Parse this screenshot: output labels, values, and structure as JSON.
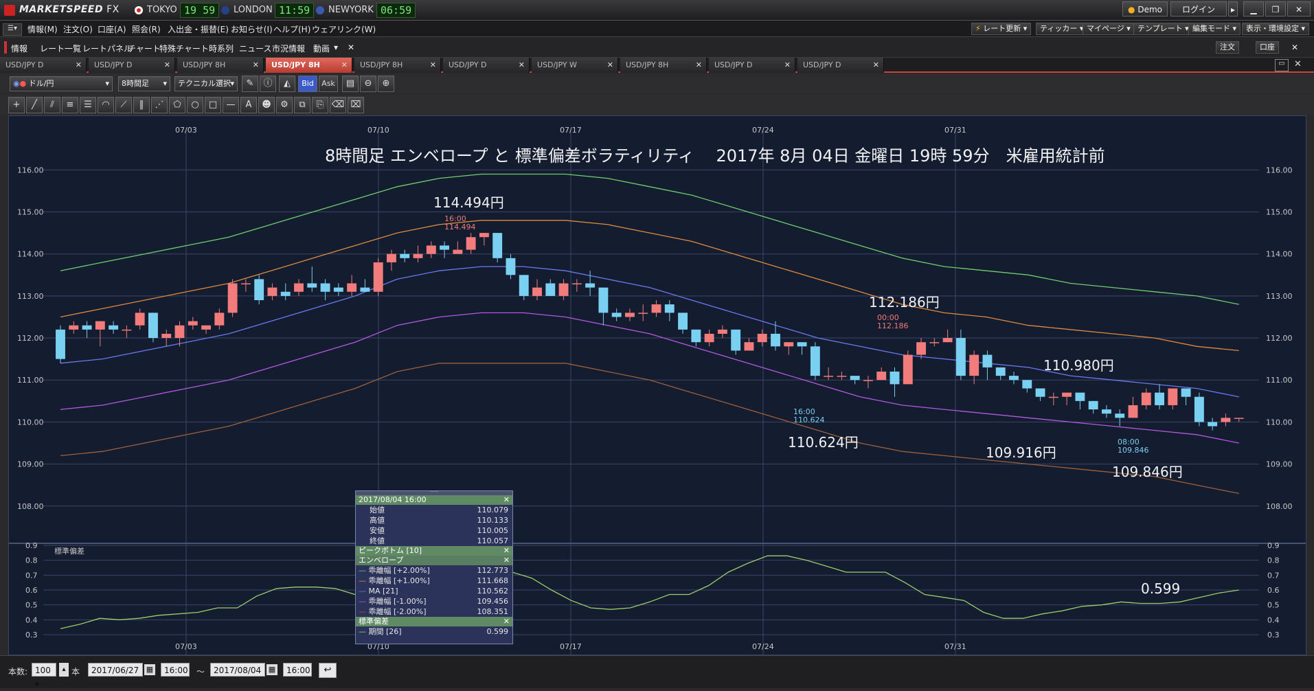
{
  "app": {
    "brand": "MARKETSPEED",
    "brand_suffix": "FX",
    "clocks": [
      {
        "city": "TOKYO",
        "time": "19 59"
      },
      {
        "city": "LONDON",
        "time": "11:59"
      },
      {
        "city": "NEWYORK",
        "time": "06:59"
      }
    ],
    "demo_label": "Demo",
    "login_label": "ログイン"
  },
  "menu": [
    "情報(M)",
    "注文(O)",
    "口座(A)",
    "照会(R)",
    "入出金・振替(E)",
    "お知らせ(I)",
    "ヘルプ(H)",
    "ウェアリンク(W)"
  ],
  "right_menu": [
    "レート更新",
    "ティッカー",
    "マイページ",
    "テンプレート",
    "編集モード",
    "表示・環境設定"
  ],
  "func_items": [
    "情報",
    "レート一覧",
    "レートパネル",
    "チャート",
    "特殊チャート",
    "時系列",
    "ニュース",
    "市況情報",
    "動画"
  ],
  "func_right": [
    "注文",
    "口座"
  ],
  "tabs": [
    "USD/JPY D",
    "USD/JPY D",
    "USD/JPY 8H",
    "USD/JPY 8H",
    "USD/JPY 8H",
    "USD/JPY D",
    "USD/JPY W",
    "USD/JPY 8H",
    "USD/JPY D",
    "USD/JPY D"
  ],
  "active_tab": 3,
  "toolbar": {
    "pair": "ドル/円",
    "interval": "8時間足",
    "technical": "テクニカル選択",
    "bid": "Bid",
    "ask": "Ask"
  },
  "chart_data": {
    "type": "candlestick",
    "title": "8時間足 エンベロープ と 標準偏差ボラティリティ　 2017年 8月 04日 金曜日 19時 59分　米雇用統計前",
    "x_dates": [
      "07/03",
      "07/10",
      "07/17",
      "07/24",
      "07/31"
    ],
    "y_ticks": [
      "116.00",
      "115.00",
      "114.00",
      "113.00",
      "112.00",
      "111.00",
      "110.00",
      "109.00",
      "108.00"
    ],
    "ylim": [
      107.8,
      116.3
    ],
    "candles": [
      [
        112.2,
        111.5,
        112.3,
        111.4
      ],
      [
        112.2,
        112.3,
        112.4,
        112.1
      ],
      [
        112.3,
        112.2,
        112.4,
        112.0
      ],
      [
        112.2,
        112.4,
        112.4,
        111.8
      ],
      [
        112.3,
        112.2,
        112.4,
        112.1
      ],
      [
        112.2,
        112.2,
        112.3,
        112.0
      ],
      [
        112.3,
        112.6,
        112.7,
        112.2
      ],
      [
        112.6,
        112.0,
        112.6,
        111.9
      ],
      [
        112.0,
        112.1,
        112.2,
        111.8
      ],
      [
        112.0,
        112.3,
        112.4,
        111.8
      ],
      [
        112.3,
        112.4,
        112.5,
        112.2
      ],
      [
        112.2,
        112.3,
        112.3,
        112.1
      ],
      [
        112.3,
        112.6,
        112.7,
        112.2
      ],
      [
        112.6,
        113.3,
        113.4,
        112.5
      ],
      [
        113.3,
        113.3,
        113.4,
        113.1
      ],
      [
        113.4,
        112.9,
        113.5,
        112.8
      ],
      [
        113.0,
        113.2,
        113.3,
        112.9
      ],
      [
        113.1,
        113.0,
        113.3,
        112.9
      ],
      [
        113.1,
        113.3,
        113.4,
        113.0
      ],
      [
        113.3,
        113.2,
        113.7,
        113.1
      ],
      [
        113.3,
        113.1,
        113.4,
        112.9
      ],
      [
        113.2,
        113.1,
        113.3,
        113.0
      ],
      [
        113.1,
        113.3,
        113.5,
        113.0
      ],
      [
        113.2,
        113.1,
        113.4,
        113.1
      ],
      [
        113.1,
        113.8,
        113.9,
        113.0
      ],
      [
        113.8,
        114.0,
        114.1,
        113.6
      ],
      [
        114.0,
        113.9,
        114.1,
        113.8
      ],
      [
        113.9,
        114.0,
        114.2,
        113.8
      ],
      [
        114.0,
        114.2,
        114.3,
        113.9
      ],
      [
        114.2,
        114.1,
        114.3,
        113.9
      ],
      [
        114.0,
        114.1,
        114.3,
        114.0
      ],
      [
        114.1,
        114.4,
        114.5,
        114.0
      ],
      [
        114.4,
        114.5,
        114.5,
        114.2
      ],
      [
        114.5,
        113.9,
        114.5,
        113.8
      ],
      [
        113.9,
        113.5,
        114.0,
        113.4
      ],
      [
        113.5,
        113.0,
        113.5,
        112.9
      ],
      [
        113.0,
        113.2,
        113.4,
        112.9
      ],
      [
        113.3,
        113.0,
        113.4,
        113.0
      ],
      [
        113.0,
        113.3,
        113.4,
        112.9
      ],
      [
        113.3,
        113.3,
        113.4,
        113.1
      ],
      [
        113.3,
        113.2,
        113.6,
        113.0
      ],
      [
        113.2,
        112.6,
        113.2,
        112.3
      ],
      [
        112.6,
        112.5,
        112.7,
        112.4
      ],
      [
        112.5,
        112.6,
        112.7,
        112.4
      ],
      [
        112.6,
        112.6,
        112.8,
        112.4
      ],
      [
        112.6,
        112.8,
        112.9,
        112.5
      ],
      [
        112.8,
        112.6,
        112.9,
        112.4
      ],
      [
        112.6,
        112.2,
        112.6,
        112.1
      ],
      [
        112.2,
        111.9,
        112.2,
        111.8
      ],
      [
        111.9,
        112.1,
        112.2,
        111.8
      ],
      [
        112.1,
        112.2,
        112.3,
        112.0
      ],
      [
        112.2,
        111.7,
        112.2,
        111.6
      ],
      [
        111.7,
        111.9,
        112.0,
        111.7
      ],
      [
        111.9,
        112.1,
        112.2,
        111.8
      ],
      [
        112.1,
        111.8,
        112.4,
        111.7
      ],
      [
        111.8,
        111.9,
        111.9,
        111.6
      ],
      [
        111.9,
        111.8,
        111.9,
        111.6
      ],
      [
        111.8,
        111.1,
        111.9,
        111.0
      ],
      [
        111.1,
        111.1,
        111.3,
        111.0
      ],
      [
        111.1,
        111.1,
        111.2,
        111.0
      ],
      [
        111.1,
        111.0,
        111.1,
        110.9
      ],
      [
        111.0,
        111.0,
        111.1,
        110.8
      ],
      [
        111.0,
        111.2,
        111.3,
        111.0
      ],
      [
        111.2,
        110.9,
        111.3,
        110.6
      ],
      [
        110.9,
        111.6,
        111.7,
        110.9
      ],
      [
        111.6,
        111.9,
        112.0,
        111.5
      ],
      [
        111.9,
        111.9,
        112.0,
        111.8
      ],
      [
        111.9,
        112.0,
        112.2,
        111.9
      ],
      [
        112.0,
        111.1,
        112.2,
        111.0
      ],
      [
        111.1,
        111.6,
        111.7,
        110.9
      ],
      [
        111.6,
        111.3,
        111.7,
        111.0
      ],
      [
        111.3,
        111.1,
        111.3,
        111.0
      ],
      [
        111.1,
        111.0,
        111.2,
        110.9
      ],
      [
        111.0,
        110.8,
        111.0,
        110.7
      ],
      [
        110.8,
        110.6,
        110.8,
        110.5
      ],
      [
        110.6,
        110.6,
        110.7,
        110.4
      ],
      [
        110.6,
        110.7,
        110.7,
        110.4
      ],
      [
        110.7,
        110.5,
        110.7,
        110.3
      ],
      [
        110.5,
        110.3,
        110.5,
        110.2
      ],
      [
        110.3,
        110.2,
        110.4,
        110.1
      ],
      [
        110.2,
        110.1,
        110.3,
        109.9
      ],
      [
        110.1,
        110.4,
        110.6,
        110.1
      ],
      [
        110.4,
        110.7,
        110.8,
        110.3
      ],
      [
        110.7,
        110.4,
        110.9,
        110.3
      ],
      [
        110.4,
        110.8,
        110.8,
        110.3
      ],
      [
        110.8,
        110.6,
        110.8,
        110.4
      ],
      [
        110.6,
        110.0,
        110.7,
        109.9
      ],
      [
        110.0,
        109.9,
        110.1,
        109.8
      ],
      [
        110.0,
        110.1,
        110.2,
        109.9
      ],
      [
        110.1,
        110.1,
        110.1,
        110.0
      ]
    ],
    "envelope_plus2": [
      113.6,
      113.8,
      114.0,
      114.2,
      114.4,
      114.7,
      115.0,
      115.3,
      115.6,
      115.8,
      115.9,
      115.9,
      115.9,
      115.8,
      115.6,
      115.4,
      115.1,
      114.8,
      114.5,
      114.2,
      113.9,
      113.7,
      113.6,
      113.5,
      113.3,
      113.2,
      113.1,
      113.0,
      112.8
    ],
    "envelope_plus1": [
      112.5,
      112.7,
      112.9,
      113.1,
      113.3,
      113.6,
      113.9,
      114.2,
      114.5,
      114.7,
      114.8,
      114.8,
      114.8,
      114.7,
      114.5,
      114.3,
      114.0,
      113.7,
      113.4,
      113.1,
      112.8,
      112.6,
      112.5,
      112.3,
      112.2,
      112.1,
      112.0,
      111.8,
      111.7
    ],
    "ma21": [
      111.4,
      111.5,
      111.7,
      111.9,
      112.1,
      112.4,
      112.7,
      113.0,
      113.4,
      113.6,
      113.7,
      113.7,
      113.6,
      113.4,
      113.2,
      112.9,
      112.6,
      112.3,
      112.0,
      111.8,
      111.6,
      111.5,
      111.4,
      111.3,
      111.1,
      111.0,
      110.9,
      110.8,
      110.6
    ],
    "envelope_minus1": [
      110.3,
      110.4,
      110.6,
      110.8,
      111.0,
      111.3,
      111.6,
      111.9,
      112.3,
      112.5,
      112.6,
      112.6,
      112.5,
      112.3,
      112.1,
      111.8,
      111.5,
      111.2,
      110.9,
      110.6,
      110.4,
      110.3,
      110.2,
      110.1,
      110.0,
      109.9,
      109.8,
      109.7,
      109.5
    ],
    "envelope_minus2": [
      109.2,
      109.3,
      109.5,
      109.7,
      109.9,
      110.2,
      110.5,
      110.8,
      111.2,
      111.4,
      111.4,
      111.4,
      111.4,
      111.2,
      111.0,
      110.7,
      110.4,
      110.1,
      109.8,
      109.5,
      109.3,
      109.2,
      109.1,
      109.0,
      108.9,
      108.8,
      108.7,
      108.5,
      108.3
    ],
    "annotations": [
      {
        "label": "114.494円",
        "sub1": "16:00",
        "sub2": "114.494"
      },
      {
        "label": "112.186円",
        "sub1": "00:00",
        "sub2": "112.186"
      },
      {
        "label": "110.980円"
      },
      {
        "label": "110.624円",
        "sub1": "16:00",
        "sub2": "110.624"
      },
      {
        "label": "109.916円"
      },
      {
        "label": "109.846円",
        "sub1": "08:00",
        "sub2": "109.846"
      }
    ],
    "sub_chart": {
      "label": "標準偏差",
      "y_ticks": [
        "0.9",
        "0.8",
        "0.7",
        "0.6",
        "0.5",
        "0.4",
        "0.3"
      ],
      "ylim": [
        0.3,
        0.9
      ],
      "values": [
        0.34,
        0.37,
        0.41,
        0.4,
        0.41,
        0.43,
        0.44,
        0.45,
        0.48,
        0.48,
        0.56,
        0.61,
        0.62,
        0.62,
        0.61,
        0.57,
        0.52,
        0.5,
        0.52,
        0.56,
        0.62,
        0.66,
        0.7,
        0.72,
        0.68,
        0.6,
        0.53,
        0.48,
        0.47,
        0.48,
        0.52,
        0.57,
        0.57,
        0.63,
        0.72,
        0.78,
        0.83,
        0.83,
        0.8,
        0.76,
        0.72,
        0.72,
        0.72,
        0.65,
        0.57,
        0.55,
        0.53,
        0.45,
        0.41,
        0.41,
        0.44,
        0.46,
        0.49,
        0.5,
        0.52,
        0.51,
        0.51,
        0.52,
        0.55,
        0.58,
        0.6
      ],
      "last_value_label": "0.599"
    }
  },
  "infobox": {
    "header_date": "2017/08/04 16:00",
    "ohlc": [
      {
        "label": "始値",
        "value": "110.079"
      },
      {
        "label": "高値",
        "value": "110.133"
      },
      {
        "label": "安値",
        "value": "110.005"
      },
      {
        "label": "終値",
        "value": "110.057"
      }
    ],
    "section2": "ピークボトム [10]",
    "section3": "エンベロープ",
    "envelope": [
      {
        "label": "乖離幅 [+2.00%]",
        "value": "112.773",
        "color": "#6fcf6f"
      },
      {
        "label": "乖離幅 [+1.00%]",
        "value": "111.668",
        "color": "#e08a3c"
      },
      {
        "label": "MA [21]",
        "value": "110.562",
        "color": "#6a7af0"
      },
      {
        "label": "乖離幅 [-1.00%]",
        "value": "109.456",
        "color": "#b45ae0"
      },
      {
        "label": "乖離幅 [-2.00%]",
        "value": "108.351",
        "color": "#a0603a"
      }
    ],
    "section4": "標準偏差",
    "stdev": {
      "label": "期間 [26]",
      "value": "0.599"
    }
  },
  "status": {
    "count_label": "本数:",
    "count_value": "100",
    "unit": "本",
    "from_date": "2017/06/27",
    "from_time": "16:00",
    "to_date": "2017/08/04",
    "to_time": "16:00"
  },
  "colors": {
    "up": "#f27b7b",
    "down": "#7ad0f0",
    "plus2": "#6fcf6f",
    "plus1": "#e08a3c",
    "ma": "#6a7af0",
    "minus1": "#b45ae0",
    "minus2": "#a0603a",
    "stdev": "#9ad06a"
  }
}
